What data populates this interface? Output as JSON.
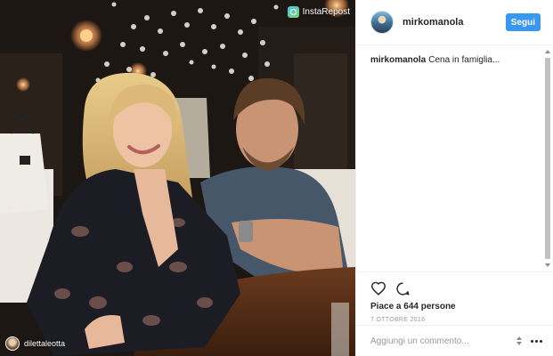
{
  "photo": {
    "repost_label": "InstaRepost",
    "credit_user": "dilettaleotta"
  },
  "post": {
    "username": "mirkomanola",
    "follow_label": "Segui",
    "caption_user": "mirkomanola",
    "caption_text": "Cena in famiglia..."
  },
  "actions": {
    "likes_text": "Piace a 644 persone",
    "date_text": "7 OTTOBRE 2016"
  },
  "comment_box": {
    "placeholder": "Aggiungi un commento..."
  },
  "icons": {
    "like": "heart-icon",
    "comment": "comment-bubble-icon",
    "more": "more-options-icon"
  },
  "colors": {
    "accent": "#3897f0",
    "text": "#262626",
    "muted": "#999999",
    "border": "#efefef"
  }
}
